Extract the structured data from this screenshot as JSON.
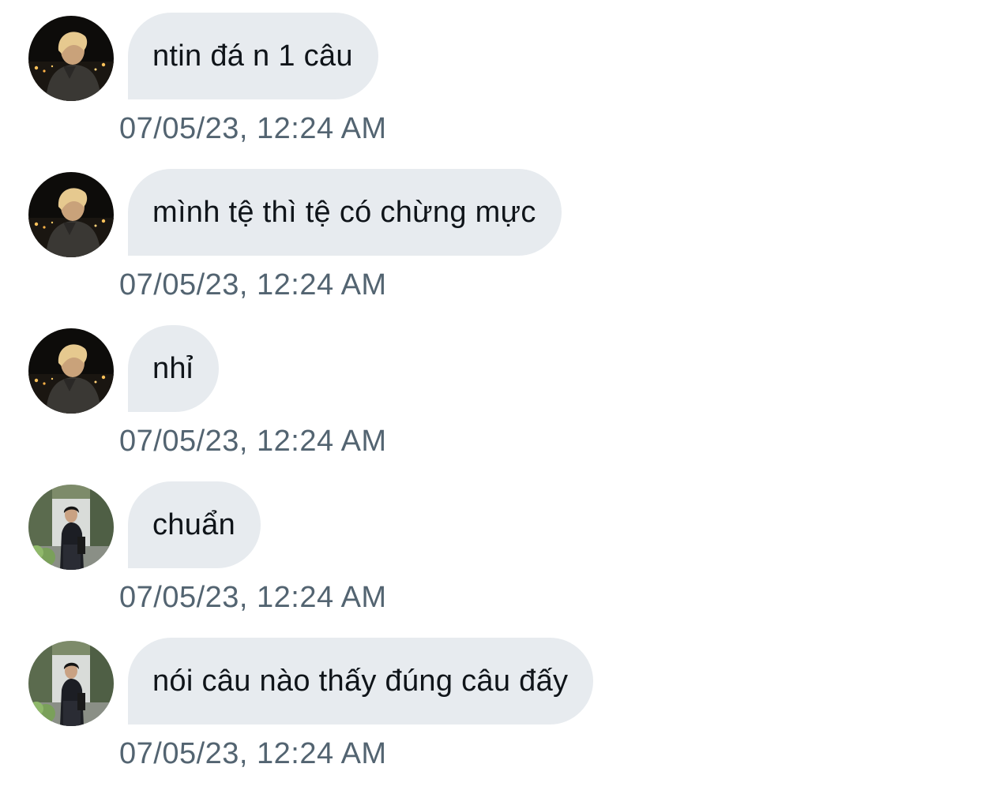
{
  "messages": [
    {
      "sender": "user-a",
      "text": "ntin đá n 1 câu",
      "timestamp": "07/05/23, 12:24 AM"
    },
    {
      "sender": "user-a",
      "text": "mình tệ thì tệ có chừng mực",
      "timestamp": "07/05/23, 12:24 AM"
    },
    {
      "sender": "user-a",
      "text": "nhỉ",
      "timestamp": "07/05/23, 12:24 AM"
    },
    {
      "sender": "user-b",
      "text": "chuẩn",
      "timestamp": "07/05/23, 12:24 AM"
    },
    {
      "sender": "user-b",
      "text": "nói câu nào thấy đúng câu đấy",
      "timestamp": "07/05/23, 12:24 AM"
    }
  ],
  "colors": {
    "bubble": "#e7ebef",
    "text": "#0f1419",
    "timestamp": "#536471"
  }
}
